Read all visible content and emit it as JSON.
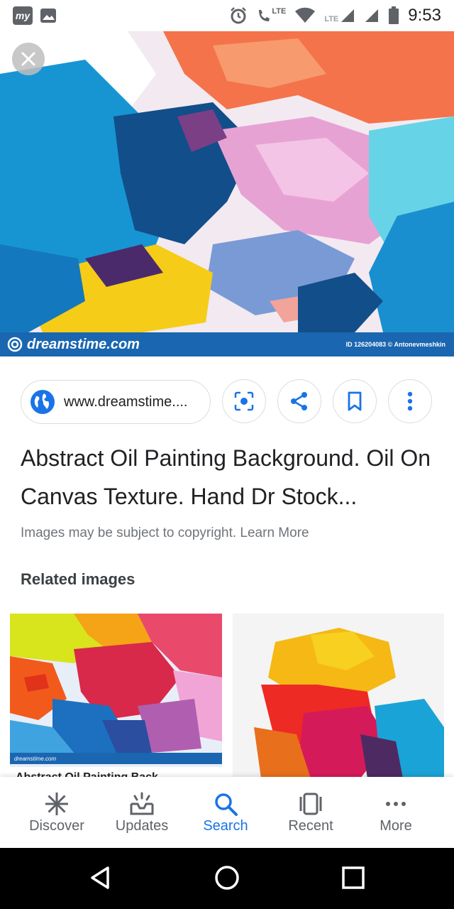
{
  "status_bar": {
    "time": "9:53",
    "app_badge": "my",
    "lte_label": "LTE",
    "icons": [
      "my-app-icon",
      "gallery-icon",
      "alarm-icon",
      "volte-call-icon",
      "wifi-icon",
      "signal-icon",
      "signal-icon",
      "battery-icon"
    ]
  },
  "hero": {
    "watermark_brand": "dreamstime.com",
    "watermark_id": "ID 126204083 © Antonevmeshkin",
    "close_icon": "close-icon"
  },
  "actions": {
    "site_url": "www.dreamstime....",
    "site_icon": "globe-icon",
    "lens_icon": "lens-icon",
    "share_icon": "share-icon",
    "bookmark_icon": "bookmark-icon",
    "more_icon": "more-vert-icon"
  },
  "result": {
    "title": "Abstract Oil Painting Background. Oil On Canvas Texture. Hand Dr Stock...",
    "copyright": "Images may be subject to copyright. Learn More"
  },
  "related": {
    "heading": "Related images",
    "thumb1_brand": "dreamstime.com",
    "thumb1_caption": "Abstract Oil Painting Back..."
  },
  "bottom_nav": {
    "items": [
      {
        "label": "Discover",
        "icon": "asterisk-icon"
      },
      {
        "label": "Updates",
        "icon": "updates-tray-icon"
      },
      {
        "label": "Search",
        "icon": "search-icon"
      },
      {
        "label": "Recent",
        "icon": "recent-tabs-icon"
      },
      {
        "label": "More",
        "icon": "more-horiz-icon"
      }
    ],
    "active": "Search"
  },
  "colors": {
    "accent": "#1a73e8",
    "watermark_bar": "#1a66b0",
    "text_primary": "#202124",
    "text_secondary": "#70757a"
  }
}
